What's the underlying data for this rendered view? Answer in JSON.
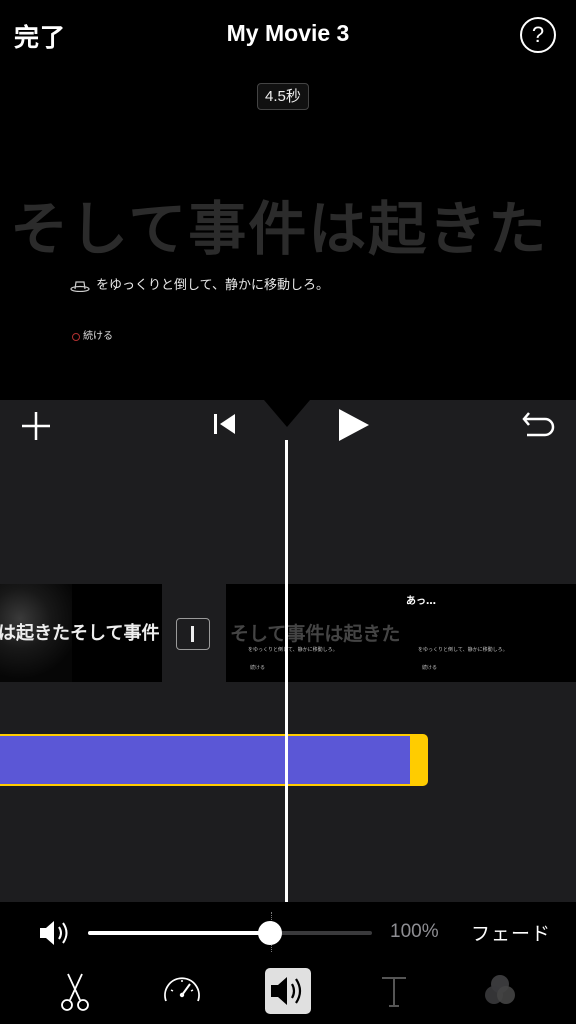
{
  "header": {
    "done_label": "完了",
    "title": "My Movie 3",
    "help_label": "?"
  },
  "clip_duration": "4.5秒",
  "preview": {
    "headline": "そして事件は起きた",
    "instruction": "をゆっくりと倒して、静かに移動しろ。",
    "continue_label": "続ける"
  },
  "controls": {
    "add_icon": "plus-icon",
    "skip_back_icon": "skip-to-start-icon",
    "play_icon": "play-icon",
    "undo_icon": "undo-icon"
  },
  "timeline": {
    "clip_a_text": "は起きたそして事件",
    "clip_b_text": "そして事件は起きた",
    "clip_b_title": "あっ…",
    "clip_b_line": "をゆっくりと倒して、静かに移動しろ。",
    "clip_b_continue": "続ける",
    "audio_clip_color": "#5b57d6",
    "selection_color": "#ffcc00"
  },
  "inspector": {
    "volume_level": 0.64,
    "volume_value": "100%",
    "fade_label": "フェード"
  },
  "toolbar": {
    "tools": [
      "scissors-icon",
      "speed-gauge-icon",
      "volume-icon",
      "text-icon",
      "filter-icon"
    ],
    "active_tool": "volume-icon"
  }
}
